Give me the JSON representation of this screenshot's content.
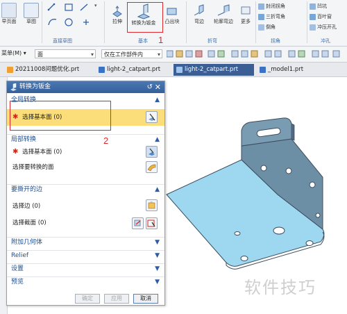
{
  "ribbon": {
    "left_buttons": [
      {
        "label": "草图"
      },
      {
        "label": "早页面"
      }
    ],
    "direct_sketch_label": "直接草图",
    "buttons": [
      {
        "label": "拉伸"
      },
      {
        "label": "转换为钣金"
      },
      {
        "label": "凸出块"
      },
      {
        "label": "弯边"
      },
      {
        "label": "轮廓弯边"
      },
      {
        "label": "更多"
      }
    ],
    "group_labels": {
      "base": "基本",
      "bend": "折弯",
      "corner": "拐角",
      "punch": "冲孔"
    },
    "corner_items": [
      "封闭拐角",
      "三折弯角",
      "倒角"
    ],
    "punch_items": [
      "凹坑",
      "百叶窗",
      "冲压开孔"
    ],
    "annotation_1": "1"
  },
  "filterbar": {
    "menu_label": "菜单(M)",
    "face_filter": "面",
    "scope_filter": "仅在工作部件内"
  },
  "tabs": [
    {
      "label": "20211008问题优化.prt",
      "active": false
    },
    {
      "label": "light-2_catpart.prt",
      "active": false
    },
    {
      "label": "light-2_catpart.prt",
      "active": true
    },
    {
      "label": "_model1.prt",
      "active": false
    }
  ],
  "dialog": {
    "title": "转换为钣金",
    "global_section": "全局转换",
    "select_base_face": "选择基本面 (0)",
    "local_section": "局部转换",
    "local_select_base": "选择基本面 (0)",
    "local_select_convert": "选择要转换的面",
    "rip_section": "要撕开的边",
    "select_edge": "选择边 (0)",
    "select_section": "选择截面 (0)",
    "collapsed_sections": [
      "附加几何体",
      "Relief",
      "设置",
      "预览"
    ],
    "buttons": {
      "ok": "确定",
      "apply": "应用",
      "cancel": "取消"
    }
  },
  "annotation_2": "2",
  "watermark": "软件技巧",
  "colors": {
    "title_bar": "#3b6ba8",
    "highlight_row": "#fbdd7a",
    "part_face": "#9ed8f0",
    "part_edge": "#3a4b5c",
    "annotation": "#e0262c"
  }
}
